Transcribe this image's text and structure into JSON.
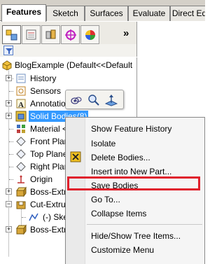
{
  "tabs": [
    {
      "label": "Features",
      "active": true
    },
    {
      "label": "Sketch",
      "active": false
    },
    {
      "label": "Surfaces",
      "active": false
    },
    {
      "label": "Evaluate",
      "active": false
    },
    {
      "label": "Direct Ed",
      "active": false
    }
  ],
  "feature_manager": {
    "more_label": "»",
    "tab_icons": [
      "feature-tree-icon",
      "property-manager-icon",
      "configuration-manager-icon",
      "dimxpert-icon",
      "display-manager-icon"
    ]
  },
  "tree": {
    "part_label": "BlogExample  (Default<<Default",
    "items": [
      {
        "label": "History",
        "icon": "history-icon"
      },
      {
        "label": "Sensors",
        "icon": "sensors-icon"
      },
      {
        "label": "Annotatio",
        "icon": "annotations-icon"
      },
      {
        "label": "Solid Bodies(8)",
        "icon": "solid-bodies-icon",
        "selected": true
      },
      {
        "label": "Material <",
        "icon": "material-icon"
      },
      {
        "label": "Front Plan",
        "icon": "plane-icon"
      },
      {
        "label": "Top Plane",
        "icon": "plane-icon"
      },
      {
        "label": "Right Plan",
        "icon": "plane-icon"
      },
      {
        "label": "Origin",
        "icon": "origin-icon"
      },
      {
        "label": "Boss-Extru",
        "icon": "boss-extrude-icon"
      },
      {
        "label": "Cut-Extru",
        "icon": "cut-extrude-icon"
      },
      {
        "label": "(-) Ske",
        "icon": "sketch-icon"
      },
      {
        "label": "Boss-Extru",
        "icon": "boss-extrude-icon"
      }
    ]
  },
  "context_toolbar": {
    "icons": [
      "hide-show-icon",
      "zoom-to-selection-icon",
      "normal-to-icon"
    ]
  },
  "context_menu": {
    "items": [
      {
        "label": "Show Feature History"
      },
      {
        "label": "Isolate"
      },
      {
        "label": "Delete Bodies..."
      },
      {
        "label": "Insert into New Part..."
      },
      {
        "label": "Save Bodies",
        "highlighted": true
      },
      {
        "label": "Go To..."
      },
      {
        "label": "Collapse Items"
      },
      {
        "label": "Hide/Show Tree Items..."
      },
      {
        "label": "Customize Menu"
      }
    ],
    "highlight_color": "#e0202c"
  },
  "colors": {
    "selection": "#3399ff",
    "tabbar": "#d4d0c8"
  }
}
